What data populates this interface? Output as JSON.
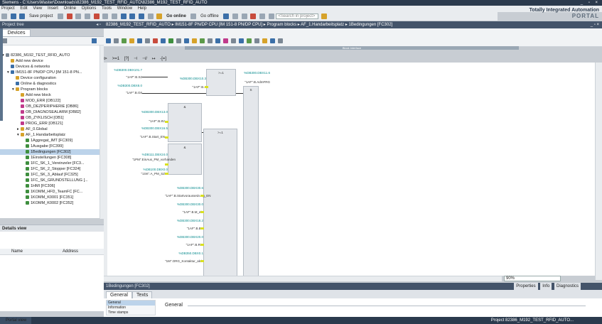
{
  "window": {
    "title": "Siemens - C:\\Users\\Master\\Downloads\\82386_M192_TEST_RFID_AUTO\\82386_M192_TEST_RFID_AUTO",
    "controls": "_ ▫ ×"
  },
  "menu": [
    "Project",
    "Edit",
    "View",
    "Insert",
    "Online",
    "Options",
    "Tools",
    "Window",
    "Help"
  ],
  "brand": {
    "line1": "Totally Integrated Automation",
    "line2": "PORTAL"
  },
  "toolbar": {
    "save_label": "Save project",
    "go_online": "Go online",
    "go_offline": "Go offline",
    "search_placeholder": "<Search in project>"
  },
  "project_tree": {
    "header": "Project tree",
    "tab": "Devices",
    "items": [
      {
        "label": "82386_M192_TEST_RFID_AUTO",
        "indent": 0,
        "icon": "ti-gray",
        "expander": "▾"
      },
      {
        "label": "Add new device",
        "indent": 1,
        "icon": "ti-yellow",
        "expander": ""
      },
      {
        "label": "Devices & networks",
        "indent": 1,
        "icon": "ti-blue",
        "expander": ""
      },
      {
        "label": "IM151-8F PN/DP CPU [IM 151-8 PN...",
        "indent": 1,
        "icon": "ti-blue",
        "expander": "▾"
      },
      {
        "label": "Device configuration",
        "indent": 2,
        "icon": "ti-yellow",
        "expander": ""
      },
      {
        "label": "Online & diagnostics",
        "indent": 2,
        "icon": "ti-blue",
        "expander": ""
      },
      {
        "label": "Program blocks",
        "indent": 2,
        "icon": "ti-yellow",
        "expander": "▾"
      },
      {
        "label": "Add new block",
        "indent": 3,
        "icon": "ti-yellow",
        "expander": ""
      },
      {
        "label": "MOD_ERR [OB122]",
        "indent": 3,
        "icon": "ti-pink",
        "expander": ""
      },
      {
        "label": "OB_DEZPERIPHERIE [OB86]",
        "indent": 3,
        "icon": "ti-pink",
        "expander": ""
      },
      {
        "label": "OB_DIAGNOSEALARM [OB82]",
        "indent": 3,
        "icon": "ti-pink",
        "expander": ""
      },
      {
        "label": "OB_ZYKLISCH [OB1]",
        "indent": 3,
        "icon": "ti-pink",
        "expander": ""
      },
      {
        "label": "PROG_ERR [OB121]",
        "indent": 3,
        "icon": "ti-pink",
        "expander": ""
      },
      {
        "label": "AF_0.Global",
        "indent": 3,
        "icon": "ti-yellow",
        "expander": "▸"
      },
      {
        "label": "AF_1.Handarbeitsplatz",
        "indent": 3,
        "icon": "ti-yellow",
        "expander": "▾"
      },
      {
        "label": "1Aggregat_IMT [FC309]",
        "indent": 4,
        "icon": "ti-green",
        "expander": ""
      },
      {
        "label": "1Ausgabe [FC399]",
        "indent": 4,
        "icon": "ti-green",
        "expander": ""
      },
      {
        "label": "1Bedingungen [FC302]",
        "indent": 4,
        "icon": "ti-green",
        "expander": "",
        "selected": true
      },
      {
        "label": "1Einstellungen [FC308]",
        "indent": 4,
        "icon": "ti-green",
        "expander": ""
      },
      {
        "label": "1FC_SK_1_Vereinzeler [FC3...",
        "indent": 4,
        "icon": "ti-green",
        "expander": ""
      },
      {
        "label": "1FC_SK_2_Stopper [FC324]",
        "indent": 4,
        "icon": "ti-green",
        "expander": ""
      },
      {
        "label": "1FC_SK_3_Ablauf [FC325]",
        "indent": 4,
        "icon": "ti-green",
        "expander": ""
      },
      {
        "label": "1FC_SK_GRUNDSTELLUNG [...",
        "indent": 4,
        "icon": "ti-green",
        "expander": ""
      },
      {
        "label": "1HMI [FC306]",
        "indent": 4,
        "icon": "ti-green",
        "expander": ""
      },
      {
        "label": "1KOMM_HFD_TeamFC [FC...",
        "indent": 4,
        "icon": "ti-green",
        "expander": ""
      },
      {
        "label": "1KOMM_K0001 [FC351]",
        "indent": 4,
        "icon": "ti-green",
        "expander": ""
      },
      {
        "label": "1KOMM_K0002 [FC352]",
        "indent": 4,
        "icon": "ti-green",
        "expander": ""
      }
    ]
  },
  "details": {
    "header": "Details view",
    "col_name": "Name",
    "col_address": "Address"
  },
  "editor": {
    "breadcrumb": "82386_M192_TEST_RFID_AUTO ▸ IM151-8F PN/DP CPU [IM 151-8 PN/DP CPU] ▸ Program blocks ▸ AF_1.Handarbeitsplatz ▸ 1Bedingungen [FC302]",
    "block_interface": "Block interface",
    "ladder_tools": [
      "⊳",
      ">=1",
      "[?]",
      "⊣",
      "⊣/",
      "↦",
      "-[=]"
    ],
    "zoom": "90%"
  },
  "network": {
    "box1_hdr": ">=1",
    "box1_op1": "%DB300.DBX101.7",
    "box1_sym1": "\"1AF\".B.S2",
    "box1_op2": "%DB300.DBX8.0",
    "box1_sym2": "\"1AF\".B.G6",
    "box1_op3": "%DB300.DBX10.3",
    "box1_sym3": "\"1AF\".B.4",
    "box2_op": "%DB300.DBX11.6",
    "box2_sym": "\"1AF\".B.AdmFRG",
    "box2_s": "S",
    "and1_hdr": "&",
    "and1_op1": "%DB300.DBX13.0",
    "and1_sym1": "\"1AF\".B.8V",
    "and1_op2": "%DB300.DBX16.5",
    "and1_sym2": "\"1AF\".B.Start_EN",
    "or2_hdr": ">=1",
    "and2_hdr": "&",
    "and2_op1": "%DB111.DBX24.0",
    "and2_sym1": "\"1PM\".EinAus_PM_vorhanden",
    "and2_op2": "%DB100.DBX0.0",
    "and2_sym2": "\"1SK\".A_PM_SZ",
    "list_ops": [
      {
        "op": "%DB300.DBX30.6",
        "sym": "\"1AF\".B.Startvoraussetzung_EN"
      },
      {
        "op": "%DB300.DBX30.0",
        "sym": "\"1AF\".B.M_ein"
      },
      {
        "op": "%DB300.DBX18.2",
        "sym": "\"1AF\".B.BR"
      },
      {
        "op": "%DB300.DBX20.0",
        "sym": "\"1AF\".B.RW"
      },
      {
        "op": "%DB350.DBX0.1",
        "sym": "\"1M\".ORG_Kontaktur_aktiv"
      }
    ]
  },
  "inspector": {
    "header": "1Bedingungen [FC302]",
    "tab_properties": "Properties",
    "tab_info": "Info",
    "tab_diagnostics": "Diagnostics",
    "tab_general": "General",
    "tab_texts": "Texts",
    "nav": [
      "General",
      "Information",
      "Time stamps"
    ],
    "section_title": "General"
  },
  "status_bar": {
    "portal_view": "Portal view",
    "project": "Project 82386_M192_TEST_RFID_AUTO..."
  }
}
